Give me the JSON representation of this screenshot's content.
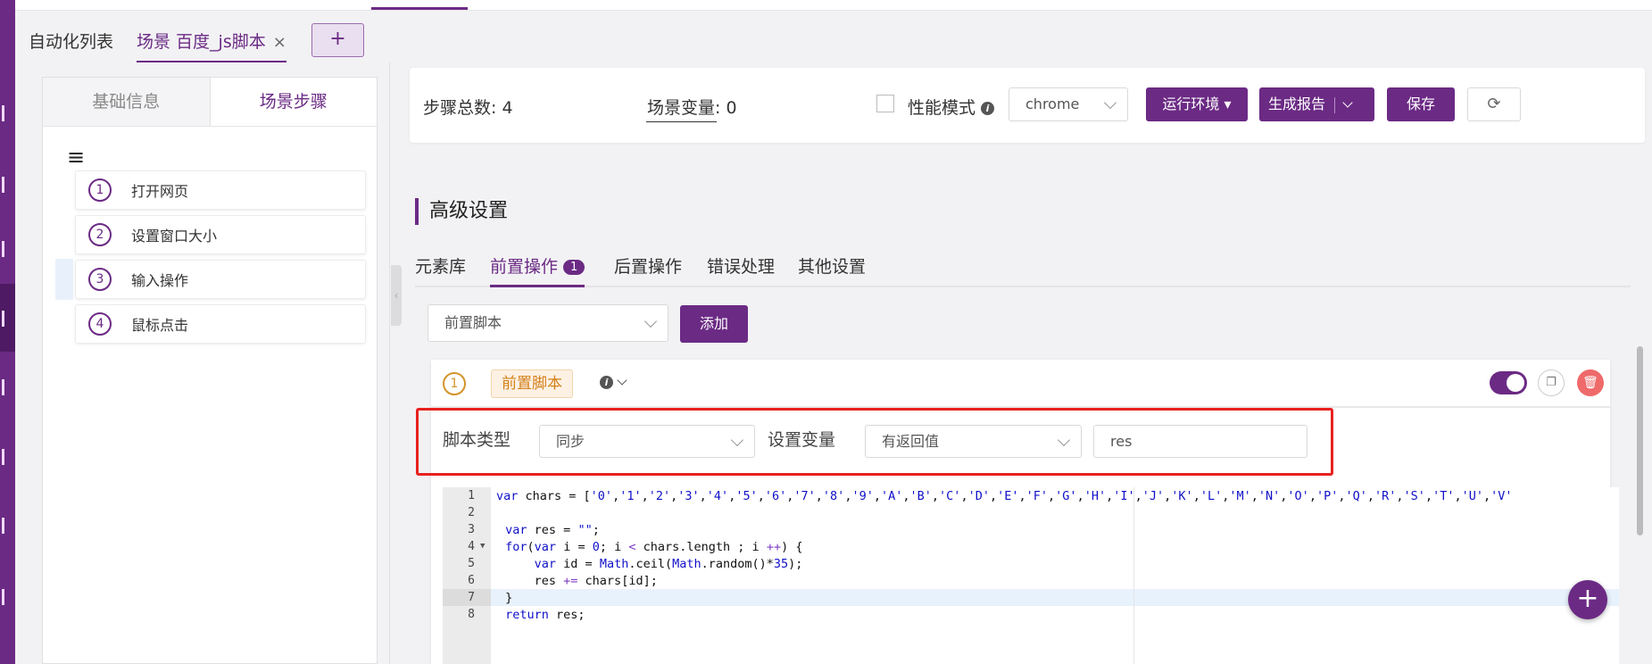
{
  "tabs": [
    {
      "label": "自动化列表"
    },
    {
      "label": "场景 百度_js脚本",
      "close": "×"
    }
  ],
  "add_tab": "+",
  "left_panel": {
    "tabs": [
      "基础信息",
      "场景步骤"
    ],
    "menu_icon": "≡",
    "steps": [
      {
        "num": "1",
        "label": "打开网页"
      },
      {
        "num": "2",
        "label": "设置窗口大小"
      },
      {
        "num": "3",
        "label": "输入操作"
      },
      {
        "num": "4",
        "label": "鼠标点击"
      }
    ]
  },
  "toprow": {
    "step_total": "步骤总数: 4",
    "scene_var": "场景变量: 0",
    "perf_mode": "性能模式",
    "browser": "chrome",
    "run_env": "运行环境",
    "gen_report": "生成报告",
    "save": "保存"
  },
  "advanced": {
    "title": "高级设置",
    "tabs": [
      "元素库",
      "前置操作",
      "后置操作",
      "错误处理",
      "其他设置"
    ],
    "badge": "1",
    "select_value": "前置脚本",
    "add_button": "添加"
  },
  "card": {
    "num": "1",
    "tag": "前置脚本",
    "script_type_label": "脚本类型",
    "script_type_value": "同步",
    "set_var_label": "设置变量",
    "set_var_value": "有返回值",
    "var_name": "res"
  },
  "code": {
    "line_numbers": [
      "1",
      "2",
      "3",
      "4",
      "5",
      "6",
      "7",
      "8"
    ]
  },
  "colors": {
    "accent": "#6b2a84",
    "highlight": "#e8211f",
    "tag": "#d4801a"
  },
  "icons": [
    "info-icon",
    "chevron-down-icon",
    "refresh-icon",
    "copy-icon",
    "trash-icon",
    "plus-icon",
    "menu-icon"
  ]
}
